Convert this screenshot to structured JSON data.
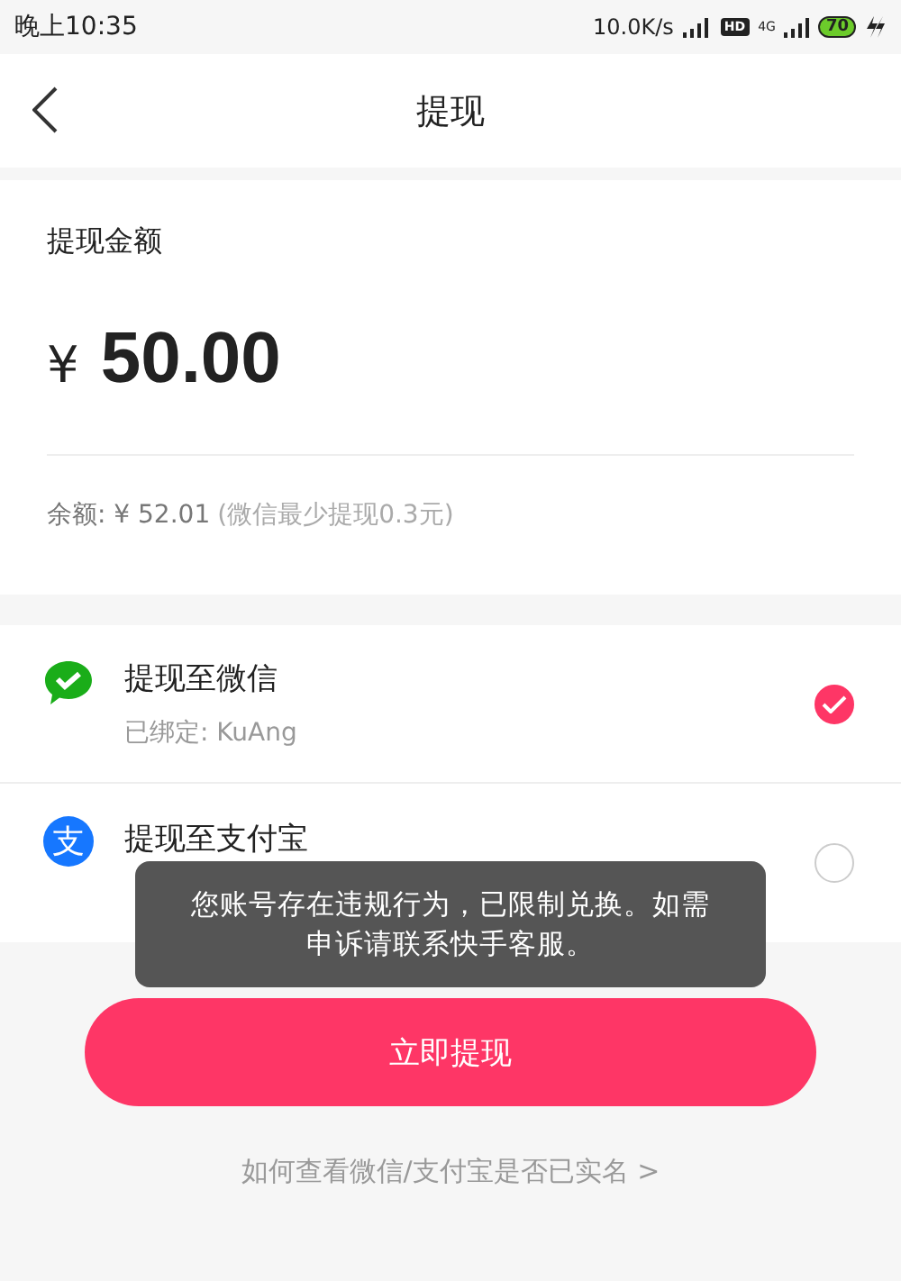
{
  "status_bar": {
    "time": "晚上10:35",
    "speed": "10.0K/s",
    "hd": "HD",
    "network": "4G",
    "battery": "70"
  },
  "header": {
    "title": "提现"
  },
  "amount_card": {
    "label": "提现金额",
    "currency": "¥",
    "amount": "50.00",
    "balance": "余额: ¥ 52.01",
    "hint": "(微信最少提现0.3元)"
  },
  "methods": [
    {
      "kind": "wechat",
      "title": "提现至微信",
      "account": "已绑定: KuAng",
      "selected": true
    },
    {
      "kind": "alipay",
      "icon_glyph": "支",
      "title": "提现至支付宝",
      "selected": false
    }
  ],
  "submit_button": "立即提现",
  "help_link": {
    "text": "如何查看微信/支付宝是否已实名",
    "arrow": ">"
  },
  "toast": "您账号存在违规行为，已限制兑换。如需申诉请联系快手客服。"
}
